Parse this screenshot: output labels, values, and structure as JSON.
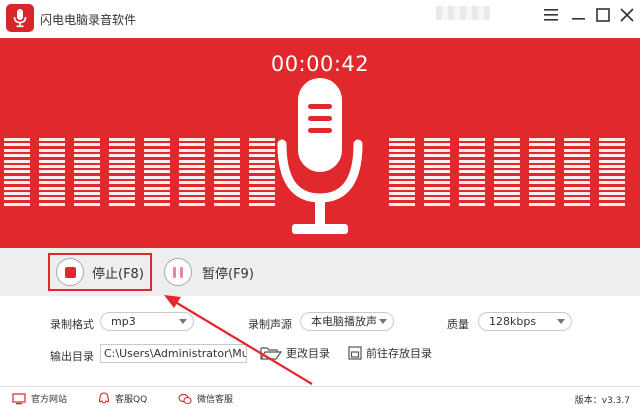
{
  "window": {
    "title": "闪电电脑录音软件",
    "controls": [
      "menu-icon",
      "minimize-icon",
      "maximize-icon",
      "close-icon"
    ]
  },
  "recorder": {
    "timer": "00:00:42",
    "icon": "microphone-icon"
  },
  "actions": {
    "stop_label": "停止(F8)",
    "pause_label": "暂停(F9)"
  },
  "settings": {
    "format_label": "录制格式",
    "format_value": "mp3",
    "source_label": "录制声源",
    "source_value": "本电脑播放声",
    "quality_label": "质量",
    "quality_value": "128kbps",
    "output_label": "输出目录",
    "output_path": "C:\\Users\\Administrator\\Music",
    "change_dir_label": "更改目录",
    "open_dir_label": "前往存放目录"
  },
  "footer": {
    "website_label": "官方网站",
    "qq_label": "客服QQ",
    "wechat_label": "微信客服",
    "version": "版本：v3.3.7"
  },
  "colors": {
    "brand_red": "#e0282d",
    "control_bg": "#eeeeee"
  }
}
